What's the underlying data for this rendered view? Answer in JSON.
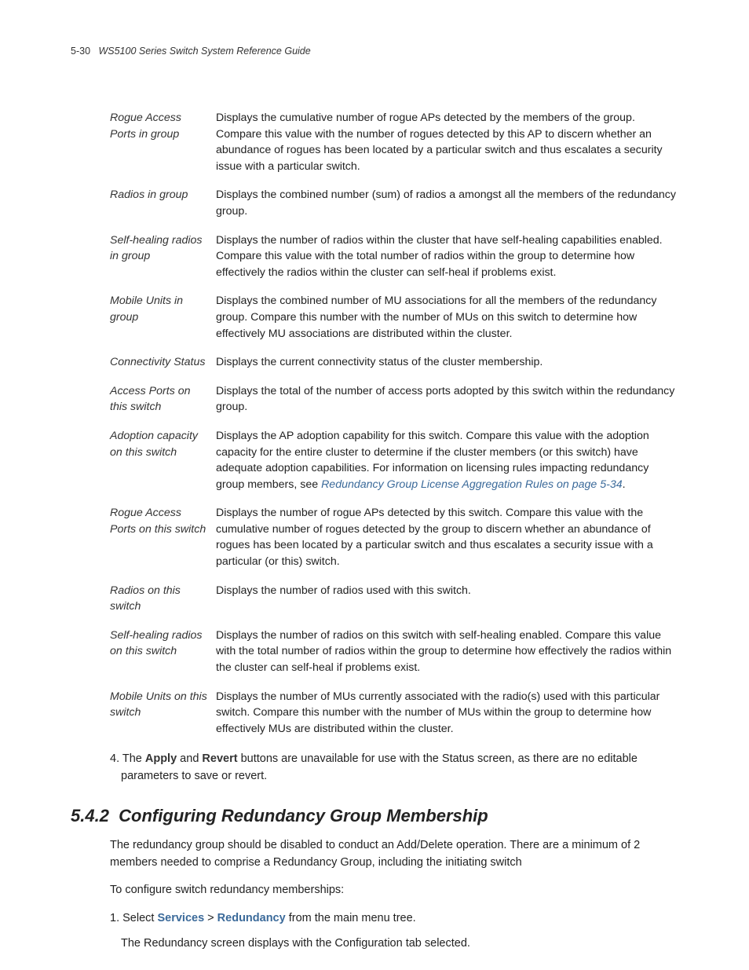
{
  "header": {
    "page_number": "5-30",
    "title": "WS5100 Series Switch System Reference Guide"
  },
  "definitions": [
    {
      "term": "Rogue Access Ports in group",
      "desc": "Displays the cumulative number of rogue APs detected by the members of the group. Compare this value with the number of rogues detected by this AP to discern whether an abundance of rogues has been located by a particular switch and thus escalates a security issue with a particular switch."
    },
    {
      "term": "Radios in group",
      "desc": "Displays the combined number (sum) of radios a amongst all the members of the redundancy group."
    },
    {
      "term": "Self-healing radios in group",
      "desc": "Displays the number of radios within the cluster that have self-healing capabilities enabled. Compare this value with the total number of radios within the group to determine how effectively the radios within the cluster can self-heal if problems exist."
    },
    {
      "term": "Mobile Units in group",
      "desc": "Displays the combined number of MU associations for all the members of the redundancy group. Compare this number with the number of MUs on this switch to determine how effectively MU associations are distributed within the cluster."
    },
    {
      "term": "Connectivity Status",
      "desc": "Displays the current connectivity status of the cluster membership."
    },
    {
      "term": "Access Ports on this switch",
      "desc": "Displays the total of the number of access ports adopted by this switch within the redundancy group."
    },
    {
      "term": "Adoption capacity on this switch",
      "desc_pre": "Displays the AP adoption capability for this switch. Compare this value with the adoption capacity for the entire cluster to determine if the cluster members (or this switch) have adequate adoption capabilities. For information on licensing rules impacting redundancy group members, see ",
      "link": "Redundancy Group License Aggregation Rules on page 5-34",
      "desc_post": "."
    },
    {
      "term": "Rogue Access Ports on this switch",
      "desc": "Displays the number of rogue APs detected by this switch. Compare this value with the cumulative number of rogues detected by the group to discern whether an abundance of rogues has been located by a particular switch and thus escalates a security issue with a particular (or this) switch."
    },
    {
      "term": "Radios on this switch",
      "desc": "Displays the number of radios used with this switch."
    },
    {
      "term": "Self-healing radios on this switch",
      "desc": "Displays the number of radios on this switch with self-healing enabled. Compare this value with the total number of radios within the group to determine how effectively the radios within the cluster can self-heal if problems exist."
    },
    {
      "term": "Mobile Units on this switch",
      "desc": "Displays the number of MUs currently associated with the radio(s) used with this particular switch. Compare this number with the number of MUs within the group to determine how effectively MUs are distributed within the cluster."
    }
  ],
  "note4": {
    "prefix": "4. ",
    "t1": "The ",
    "b1": "Apply",
    "t2": " and ",
    "b2": "Revert",
    "t3": " buttons are unavailable for use with the Status screen, as there are no editable parameters to save or revert."
  },
  "section": {
    "num": "5.4.2",
    "title": "Configuring Redundancy Group Membership",
    "p1": "The redundancy group should be disabled to conduct an Add/Delete operation. There are a minimum of 2 members needed to comprise a Redundancy Group, including the initiating switch",
    "p2": "To configure switch redundancy memberships:",
    "step1": {
      "prefix": "1. ",
      "t1": "Select ",
      "m1": "Services",
      "sep": " > ",
      "m2": "Redundancy",
      "t2": " from the main menu tree."
    },
    "step1_sub": "The Redundancy screen displays with the Configuration tab selected."
  }
}
